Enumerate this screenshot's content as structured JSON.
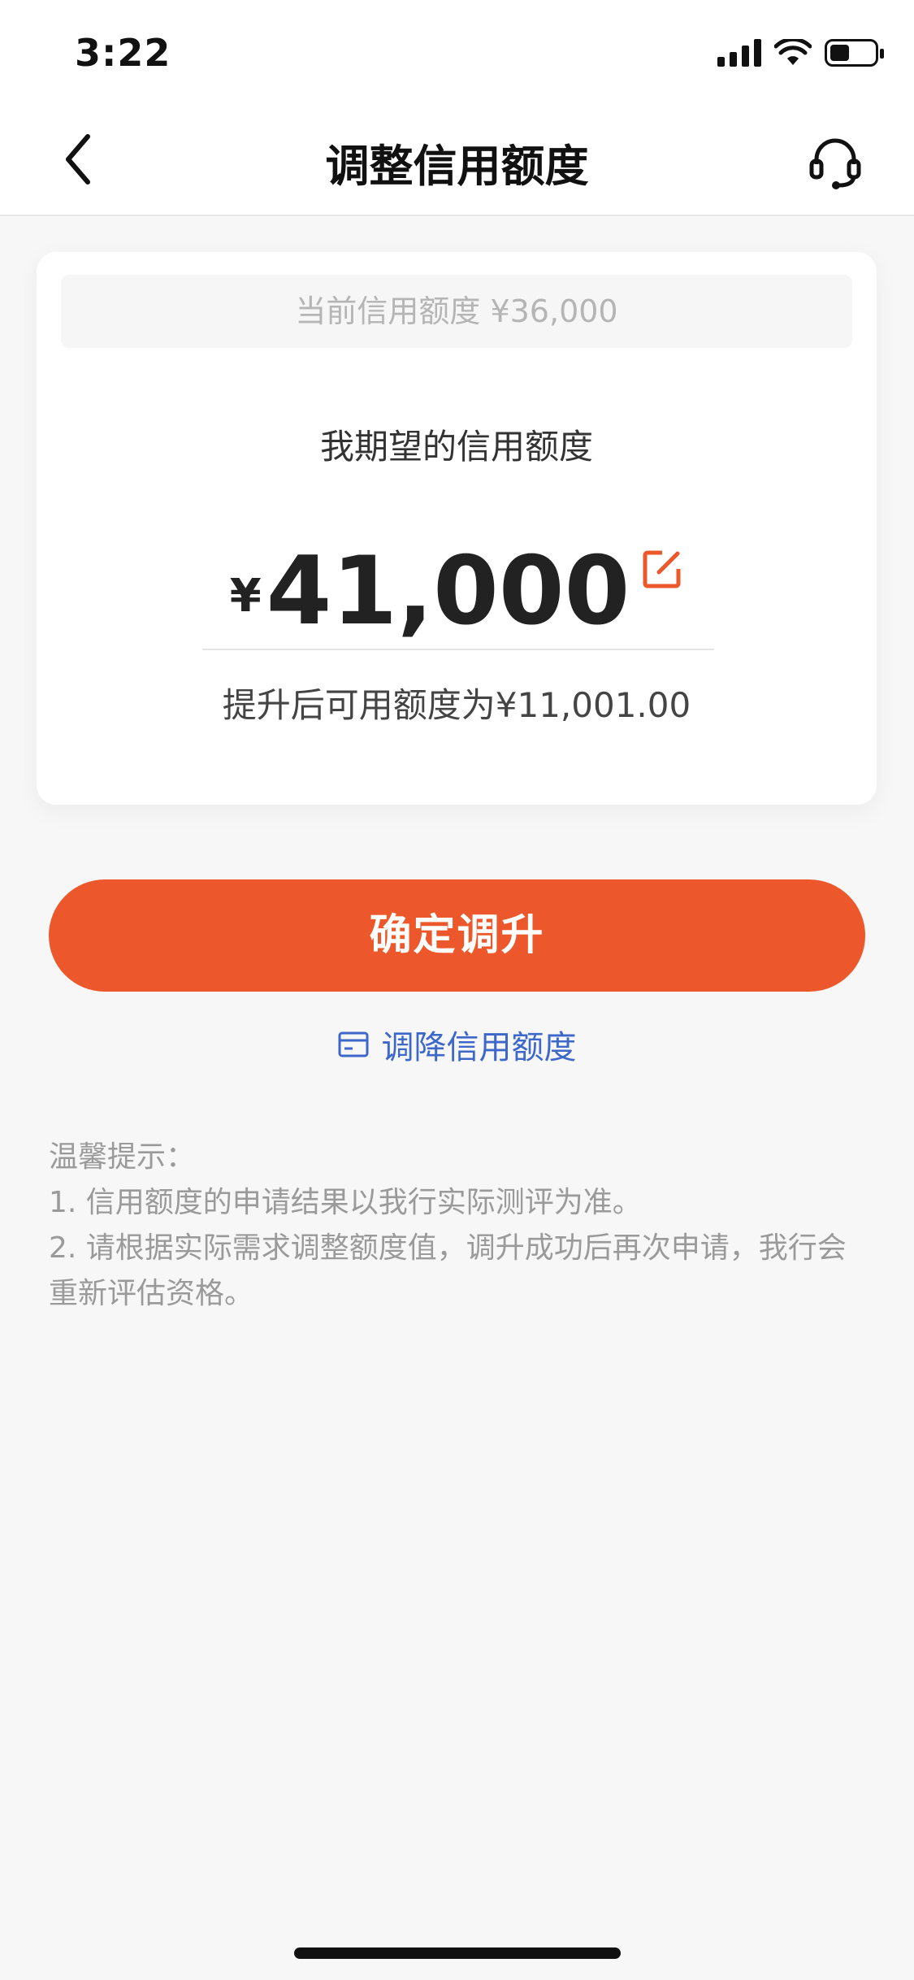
{
  "status_bar": {
    "time": "3:22"
  },
  "nav": {
    "title": "调整信用额度",
    "back_icon": "chevron-left-icon",
    "service_icon": "headset-icon"
  },
  "card": {
    "current_limit_text": "当前信用额度 ¥36,000",
    "expect_label": "我期望的信用额度",
    "currency_symbol": "¥",
    "amount": "41,000",
    "edit_icon": "edit-icon",
    "available_text": "提升后可用额度为¥11,001.00"
  },
  "actions": {
    "confirm_label": "确定调升",
    "decrease_label": "调降信用额度",
    "decrease_icon": "card-icon"
  },
  "tips": {
    "title": "温馨提示：",
    "items": [
      "1. 信用额度的申请结果以我行实际测评为准。",
      "2. 请根据实际需求调整额度值，调升成功后再次申请，我行会重新评估资格。"
    ]
  },
  "colors": {
    "accent": "#ec582c",
    "link": "#3d67c9",
    "background": "#f7f7f7"
  }
}
